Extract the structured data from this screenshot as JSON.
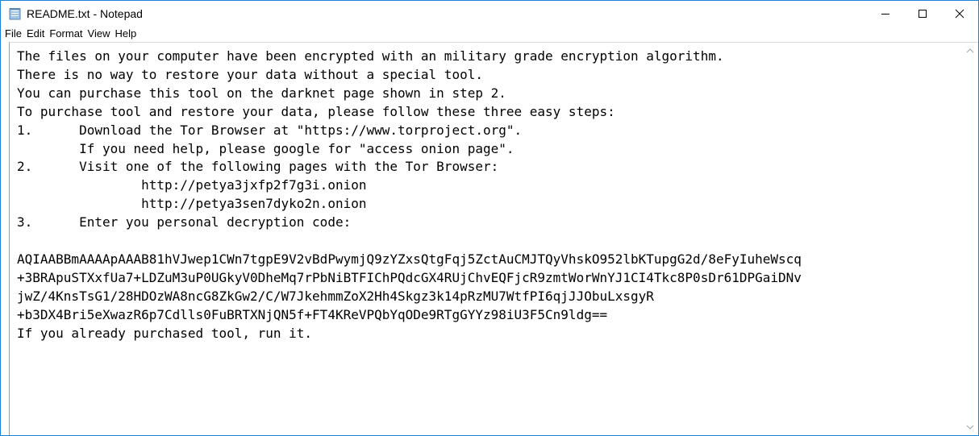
{
  "window": {
    "title": "README.txt - Notepad",
    "border_color": "#1883d7"
  },
  "controls": {
    "minimize_icon": "minimize-icon",
    "maximize_icon": "maximize-icon",
    "close_icon": "close-icon"
  },
  "menu": [
    "File",
    "Edit",
    "Format",
    "View",
    "Help"
  ],
  "document": {
    "lines": [
      "The files on your computer have been encrypted with an military grade encryption algorithm.",
      "There is no way to restore your data without a special tool.",
      "You can purchase this tool on the darknet page shown in step 2.",
      "To purchase tool and restore your data, please follow these three easy steps:",
      "1.      Download the Tor Browser at \"https://www.torproject.org\".",
      "        If you need help, please google for \"access onion page\".",
      "2.      Visit one of the following pages with the Tor Browser:",
      "                http://petya3jxfp2f7g3i.onion",
      "                http://petya3sen7dyko2n.onion",
      "3.      Enter you personal decryption code:",
      "",
      "AQIAABBmAAAApAAAB81hVJwep1CWn7tgpE9V2vBdPwymjQ9zYZxsQtgFqj5ZctAuCMJTQyVhskO952lbKTupgG2d/8eFyIuheWscq",
      "+3BRApuSTXxfUa7+LDZuM3uP0UGkyV0DheMq7rPbNiBTFIChPQdcGX4RUjChvEQFjcR9zmtWorWnYJ1CI4Tkc8P0sDr61DPGaiDNv",
      "jwZ/4KnsTsG1/28HDOzWA8ncG8ZkGw2/C/W7JkehmmZoX2Hh4Skgz3k14pRzMU7WtfPI6qjJJObuLxsgyR",
      "+b3DX4Bri5eXwazR6p7Cdlls0FuBRTXNjQN5f+FT4KReVPQbYqODe9RTgGYYz98iU3F5Cn9ldg==",
      "If you already purchased tool, run it."
    ]
  }
}
